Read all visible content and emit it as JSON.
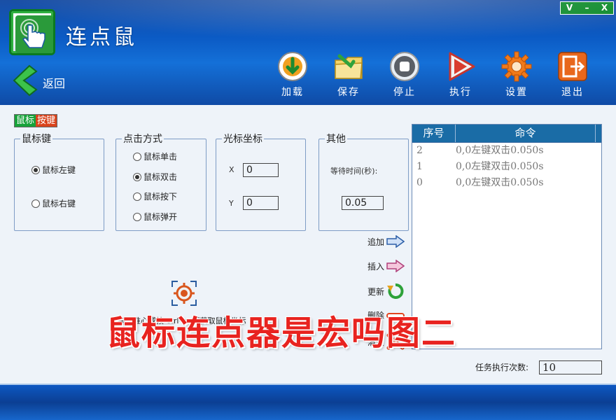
{
  "app": {
    "title": "连点鼠"
  },
  "window_controls": {
    "menu": "V",
    "minimize": "–",
    "close": "X"
  },
  "nav": {
    "back_label": "返回"
  },
  "toolbar": {
    "add": "加载",
    "save": "保存",
    "stop": "停止",
    "run": "执行",
    "settings": "设置",
    "exit": "退出"
  },
  "badge": {
    "part1": "鼠标",
    "part2": "按键"
  },
  "mouse_key": {
    "legend": "鼠标键",
    "options": [
      "鼠标左键",
      "鼠标右键"
    ],
    "selected": "鼠标左键"
  },
  "click_mode": {
    "legend": "点击方式",
    "options": [
      "鼠标单击",
      "鼠标双击",
      "鼠标按下",
      "鼠标弹开"
    ],
    "selected": "鼠标双击"
  },
  "cursor_coords": {
    "legend": "光标坐标",
    "x_label": "X",
    "x_value": "0",
    "y_label": "Y",
    "y_value": "0"
  },
  "other": {
    "legend": "其他",
    "wait_label": "等待时间(秒):",
    "wait_value": "0.05"
  },
  "capture_hint": "拖动准心或按 ctrl+x 可获取鼠标坐标",
  "actions": {
    "append": "追加",
    "insert": "插入",
    "update": "更新",
    "delete": "删除",
    "clear": "清空"
  },
  "command_list": {
    "columns": [
      "序号",
      "命令"
    ],
    "rows": [
      {
        "index": "2",
        "command": "0,0左键双击0.050s"
      },
      {
        "index": "1",
        "command": "0,0左键双击0.050s"
      },
      {
        "index": "0",
        "command": "0,0左键双击0.050s"
      }
    ]
  },
  "task_count": {
    "label": "任务执行次数:",
    "value": "10"
  },
  "watermark": "鼠标连点器是宏吗图二",
  "colors": {
    "header": "#0b5ac4",
    "accent_green": "#17a23a",
    "accent_red": "#e8231f",
    "list_header": "#1a6ca6"
  }
}
